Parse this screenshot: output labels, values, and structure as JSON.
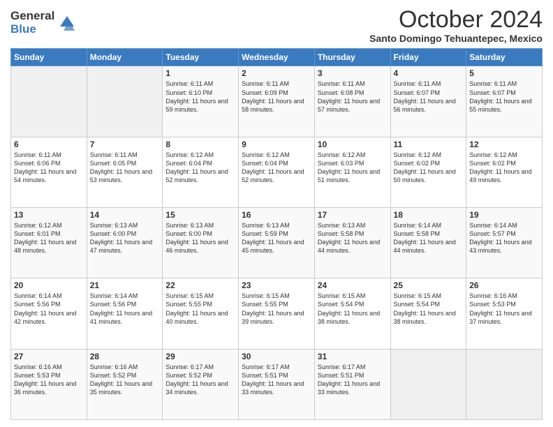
{
  "logo": {
    "general": "General",
    "blue": "Blue"
  },
  "title": "October 2024",
  "subtitle": "Santo Domingo Tehuantepec, Mexico",
  "days_header": [
    "Sunday",
    "Monday",
    "Tuesday",
    "Wednesday",
    "Thursday",
    "Friday",
    "Saturday"
  ],
  "weeks": [
    [
      {
        "day": "",
        "sunrise": "",
        "sunset": "",
        "daylight": ""
      },
      {
        "day": "",
        "sunrise": "",
        "sunset": "",
        "daylight": ""
      },
      {
        "day": "1",
        "sunrise": "Sunrise: 6:11 AM",
        "sunset": "Sunset: 6:10 PM",
        "daylight": "Daylight: 11 hours and 59 minutes."
      },
      {
        "day": "2",
        "sunrise": "Sunrise: 6:11 AM",
        "sunset": "Sunset: 6:09 PM",
        "daylight": "Daylight: 11 hours and 58 minutes."
      },
      {
        "day": "3",
        "sunrise": "Sunrise: 6:11 AM",
        "sunset": "Sunset: 6:08 PM",
        "daylight": "Daylight: 11 hours and 57 minutes."
      },
      {
        "day": "4",
        "sunrise": "Sunrise: 6:11 AM",
        "sunset": "Sunset: 6:07 PM",
        "daylight": "Daylight: 11 hours and 56 minutes."
      },
      {
        "day": "5",
        "sunrise": "Sunrise: 6:11 AM",
        "sunset": "Sunset: 6:07 PM",
        "daylight": "Daylight: 11 hours and 55 minutes."
      }
    ],
    [
      {
        "day": "6",
        "sunrise": "Sunrise: 6:11 AM",
        "sunset": "Sunset: 6:06 PM",
        "daylight": "Daylight: 11 hours and 54 minutes."
      },
      {
        "day": "7",
        "sunrise": "Sunrise: 6:11 AM",
        "sunset": "Sunset: 6:05 PM",
        "daylight": "Daylight: 11 hours and 53 minutes."
      },
      {
        "day": "8",
        "sunrise": "Sunrise: 6:12 AM",
        "sunset": "Sunset: 6:04 PM",
        "daylight": "Daylight: 11 hours and 52 minutes."
      },
      {
        "day": "9",
        "sunrise": "Sunrise: 6:12 AM",
        "sunset": "Sunset: 6:04 PM",
        "daylight": "Daylight: 11 hours and 52 minutes."
      },
      {
        "day": "10",
        "sunrise": "Sunrise: 6:12 AM",
        "sunset": "Sunset: 6:03 PM",
        "daylight": "Daylight: 11 hours and 51 minutes."
      },
      {
        "day": "11",
        "sunrise": "Sunrise: 6:12 AM",
        "sunset": "Sunset: 6:02 PM",
        "daylight": "Daylight: 11 hours and 50 minutes."
      },
      {
        "day": "12",
        "sunrise": "Sunrise: 6:12 AM",
        "sunset": "Sunset: 6:02 PM",
        "daylight": "Daylight: 11 hours and 49 minutes."
      }
    ],
    [
      {
        "day": "13",
        "sunrise": "Sunrise: 6:12 AM",
        "sunset": "Sunset: 6:01 PM",
        "daylight": "Daylight: 11 hours and 48 minutes."
      },
      {
        "day": "14",
        "sunrise": "Sunrise: 6:13 AM",
        "sunset": "Sunset: 6:00 PM",
        "daylight": "Daylight: 11 hours and 47 minutes."
      },
      {
        "day": "15",
        "sunrise": "Sunrise: 6:13 AM",
        "sunset": "Sunset: 6:00 PM",
        "daylight": "Daylight: 11 hours and 46 minutes."
      },
      {
        "day": "16",
        "sunrise": "Sunrise: 6:13 AM",
        "sunset": "Sunset: 5:59 PM",
        "daylight": "Daylight: 11 hours and 45 minutes."
      },
      {
        "day": "17",
        "sunrise": "Sunrise: 6:13 AM",
        "sunset": "Sunset: 5:58 PM",
        "daylight": "Daylight: 11 hours and 44 minutes."
      },
      {
        "day": "18",
        "sunrise": "Sunrise: 6:14 AM",
        "sunset": "Sunset: 5:58 PM",
        "daylight": "Daylight: 11 hours and 44 minutes."
      },
      {
        "day": "19",
        "sunrise": "Sunrise: 6:14 AM",
        "sunset": "Sunset: 5:57 PM",
        "daylight": "Daylight: 11 hours and 43 minutes."
      }
    ],
    [
      {
        "day": "20",
        "sunrise": "Sunrise: 6:14 AM",
        "sunset": "Sunset: 5:56 PM",
        "daylight": "Daylight: 11 hours and 42 minutes."
      },
      {
        "day": "21",
        "sunrise": "Sunrise: 6:14 AM",
        "sunset": "Sunset: 5:56 PM",
        "daylight": "Daylight: 11 hours and 41 minutes."
      },
      {
        "day": "22",
        "sunrise": "Sunrise: 6:15 AM",
        "sunset": "Sunset: 5:55 PM",
        "daylight": "Daylight: 11 hours and 40 minutes."
      },
      {
        "day": "23",
        "sunrise": "Sunrise: 6:15 AM",
        "sunset": "Sunset: 5:55 PM",
        "daylight": "Daylight: 11 hours and 39 minutes."
      },
      {
        "day": "24",
        "sunrise": "Sunrise: 6:15 AM",
        "sunset": "Sunset: 5:54 PM",
        "daylight": "Daylight: 11 hours and 38 minutes."
      },
      {
        "day": "25",
        "sunrise": "Sunrise: 6:15 AM",
        "sunset": "Sunset: 5:54 PM",
        "daylight": "Daylight: 11 hours and 38 minutes."
      },
      {
        "day": "26",
        "sunrise": "Sunrise: 6:16 AM",
        "sunset": "Sunset: 5:53 PM",
        "daylight": "Daylight: 11 hours and 37 minutes."
      }
    ],
    [
      {
        "day": "27",
        "sunrise": "Sunrise: 6:16 AM",
        "sunset": "Sunset: 5:53 PM",
        "daylight": "Daylight: 11 hours and 36 minutes."
      },
      {
        "day": "28",
        "sunrise": "Sunrise: 6:16 AM",
        "sunset": "Sunset: 5:52 PM",
        "daylight": "Daylight: 11 hours and 35 minutes."
      },
      {
        "day": "29",
        "sunrise": "Sunrise: 6:17 AM",
        "sunset": "Sunset: 5:52 PM",
        "daylight": "Daylight: 11 hours and 34 minutes."
      },
      {
        "day": "30",
        "sunrise": "Sunrise: 6:17 AM",
        "sunset": "Sunset: 5:51 PM",
        "daylight": "Daylight: 11 hours and 33 minutes."
      },
      {
        "day": "31",
        "sunrise": "Sunrise: 6:17 AM",
        "sunset": "Sunset: 5:51 PM",
        "daylight": "Daylight: 11 hours and 33 minutes."
      },
      {
        "day": "",
        "sunrise": "",
        "sunset": "",
        "daylight": ""
      },
      {
        "day": "",
        "sunrise": "",
        "sunset": "",
        "daylight": ""
      }
    ]
  ]
}
